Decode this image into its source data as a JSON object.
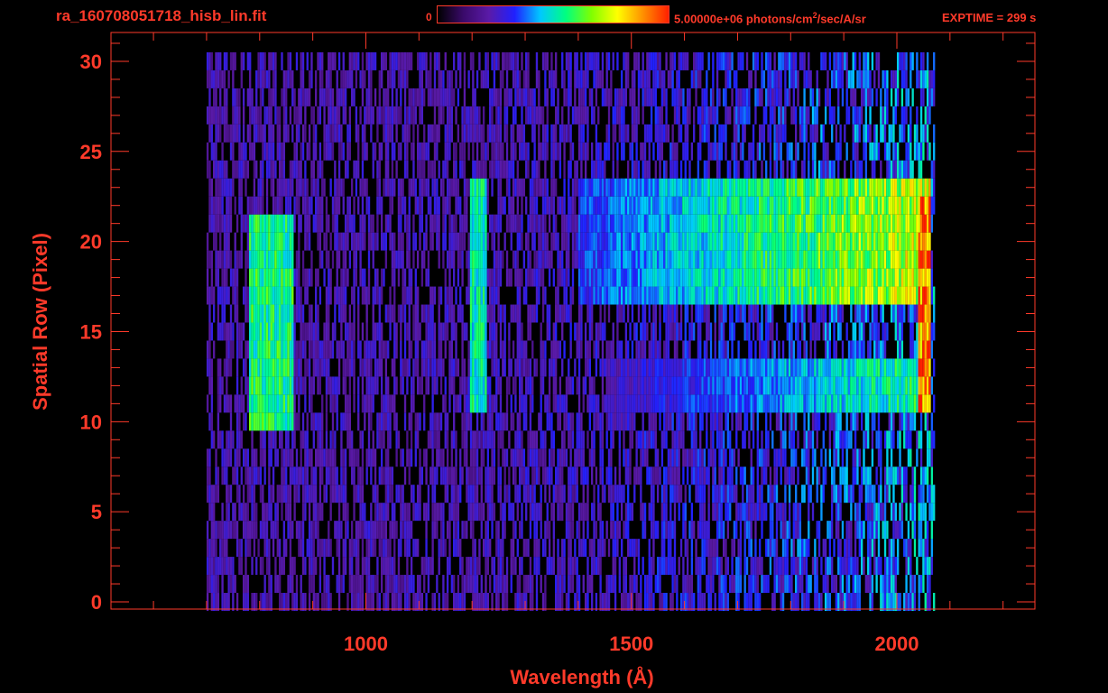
{
  "header": {
    "title": "ra_160708051718_hisb_lin.fit",
    "colorbar_min_label": "0",
    "colorbar_max_label_prefix": "5.00000e+06 photons/cm",
    "colorbar_max_label_sup": "2",
    "colorbar_max_label_suffix": "/sec/A/sr",
    "exptime_label": "EXPTIME = 299 s"
  },
  "colors": {
    "axis": "#ff3a2a",
    "background": "#000000",
    "colormap": [
      "#000000",
      "#3a0a6a",
      "#5a1aa8",
      "#2020ff",
      "#00c8ff",
      "#00ff80",
      "#80ff00",
      "#ffff00",
      "#ff9000",
      "#ff2000"
    ]
  },
  "chart_data": {
    "type": "heatmap",
    "title": "ra_160708051718_hisb_lin.fit",
    "xlabel": "Wavelength (Å)",
    "ylabel": "Spatial Row (Pixel)",
    "xlim": [
      520,
      2260
    ],
    "ylim": [
      -0.4,
      31.6
    ],
    "xticks": [
      1000,
      1500,
      2000
    ],
    "yticks": [
      0,
      5,
      10,
      15,
      20,
      25,
      30
    ],
    "colorbar": {
      "min": 0,
      "max": 5000000,
      "units": "photons/cm^2/sec/A/sr",
      "scale": "linear"
    },
    "exposure_time_s": 299,
    "data_extent": {
      "x": [
        700,
        2070
      ],
      "y": [
        0,
        30
      ]
    },
    "features": [
      {
        "label": "broad emission feature",
        "x_range": [
          780,
          860
        ],
        "y_range": [
          10,
          21
        ],
        "relative_intensity": 0.6
      },
      {
        "label": "narrow emission line",
        "x_range": [
          1195,
          1225
        ],
        "y_range": [
          11,
          23
        ],
        "relative_intensity": 0.55
      },
      {
        "label": "continuum band (upper)",
        "x_range": [
          1400,
          2060
        ],
        "y_range": [
          17,
          23
        ],
        "relative_intensity": 0.8
      },
      {
        "label": "continuum band (lower)",
        "x_range": [
          1450,
          2060
        ],
        "y_range": [
          11,
          13
        ],
        "relative_intensity": 0.6
      },
      {
        "label": "red edge peak",
        "x_range": [
          2040,
          2060
        ],
        "y_range": [
          11,
          22
        ],
        "relative_intensity": 1.0
      }
    ]
  }
}
